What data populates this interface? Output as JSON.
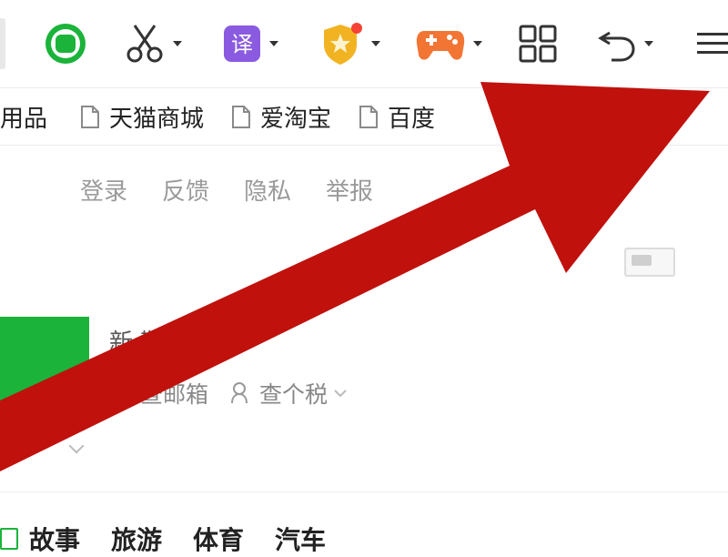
{
  "toolbar": {
    "items": [
      {
        "icon": "green-circle-icon",
        "has_caret": false
      },
      {
        "icon": "scissors-icon",
        "has_caret": true
      },
      {
        "icon": "translate-icon",
        "glyph": "译",
        "has_caret": true
      },
      {
        "icon": "shield-icon",
        "has_caret": true
      },
      {
        "icon": "gamepad-icon",
        "has_caret": true
      },
      {
        "icon": "apps-grid-icon",
        "has_caret": false
      },
      {
        "icon": "undo-icon",
        "has_caret": true
      },
      {
        "icon": "menu-icon",
        "has_caret": false
      }
    ]
  },
  "bookmarks": [
    {
      "label": "用品",
      "has_icon": false
    },
    {
      "label": "天猫商城",
      "has_icon": true
    },
    {
      "label": "爱淘宝",
      "has_icon": true
    },
    {
      "label": "百度",
      "has_icon": true
    }
  ],
  "top_links": [
    "登录",
    "反馈",
    "隐私",
    "举报"
  ],
  "profile": {
    "title": "新    鞋服饰",
    "links": [
      {
        "label": "查邮箱",
        "icon": "mail-icon"
      },
      {
        "label": "查个税",
        "icon": "person-icon"
      }
    ]
  },
  "nav": [
    "故事",
    "旅游",
    "体育",
    "汽车"
  ],
  "colors": {
    "arrow": "#c0110d",
    "green": "#1bb33a",
    "purple": "#8a5be0",
    "shield": "#f2b322",
    "gamepad": "#f27534"
  }
}
